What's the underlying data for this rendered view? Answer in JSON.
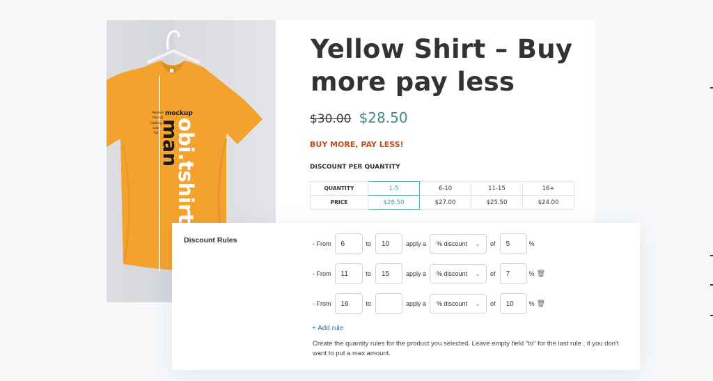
{
  "product": {
    "title": "Yellow Shirt – Buy more pay less",
    "price_old": "$30.00",
    "price_new": "$28.50",
    "promo": "BUY MORE, PAY LESS!",
    "discount_table_title": "DISCOUNT PER QUANTITY",
    "quantity_header": "QUANTITY",
    "price_header": "PRICE",
    "tiers": [
      {
        "qty": "1-5",
        "price": "$28.50"
      },
      {
        "qty": "6-10",
        "price": "$27.00"
      },
      {
        "qty": "11-15",
        "price": "$25.50"
      },
      {
        "qty": "16+",
        "price": "$24.00"
      }
    ],
    "shirt_print": {
      "mockup": "mockup",
      "brand": "obi.tshirt",
      "man": "man",
      "tiny": [
        "Number",
        "free obj",
        "Clothing",
        "color",
        "full"
      ]
    }
  },
  "rules": {
    "label": "Discount Rules",
    "from_text": "- From",
    "to_text": "to",
    "apply_text": "apply a",
    "of_text": "of",
    "percent": "%",
    "items": [
      {
        "from": "6",
        "to": "10",
        "type": "% discount",
        "amount": "5"
      },
      {
        "from": "11",
        "to": "15",
        "type": "% discount",
        "amount": "7"
      },
      {
        "from": "16",
        "to": "",
        "type": "% discount",
        "amount": "10"
      }
    ],
    "add_rule": "+ Add rule",
    "help": "Create the quantity rules for the product you selected. Leave empty field \"to\" for the last rule , if you don't want to put a max amount."
  },
  "colors": {
    "shirt": "#f4a22d",
    "accent": "#3d8c82",
    "promo": "#c14e1d",
    "link": "#2c6fb5"
  }
}
